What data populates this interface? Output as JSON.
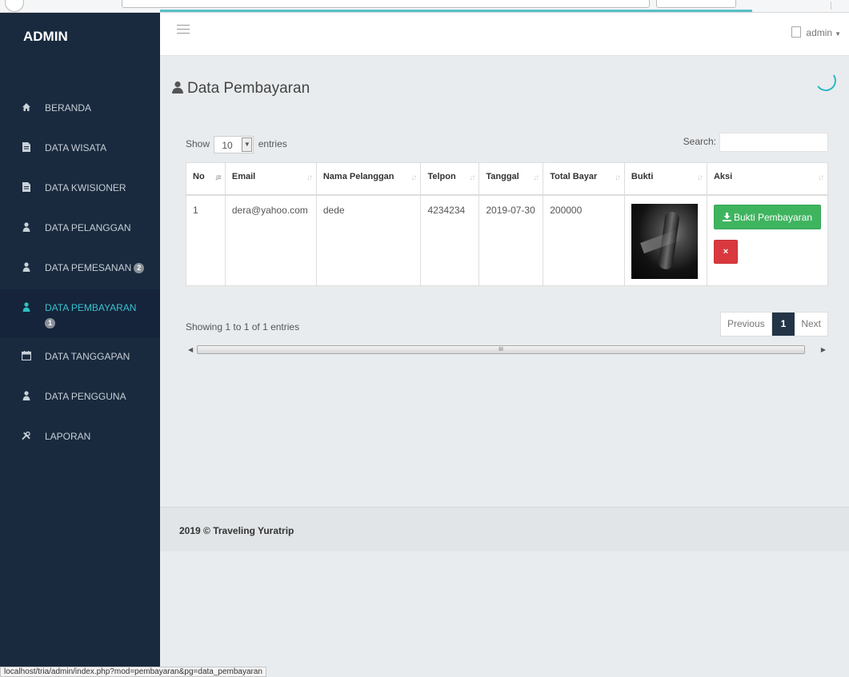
{
  "browser": {
    "status_url": "localhost/tria/admin/index.php?mod=pembayaran&pg=data_pembayaran"
  },
  "brand": "ADMIN",
  "header": {
    "user_label": "admin"
  },
  "sidebar": {
    "items": [
      {
        "label": "BERANDA",
        "icon": "home-icon"
      },
      {
        "label": "DATA WISATA",
        "icon": "file-icon"
      },
      {
        "label": "DATA KWISIONER",
        "icon": "file-icon"
      },
      {
        "label": "DATA PELANGGAN",
        "icon": "user-icon"
      },
      {
        "label": "DATA PEMESANAN",
        "icon": "user-icon",
        "badge": "2"
      },
      {
        "label": "DATA PEMBAYARAN",
        "icon": "user-icon",
        "badge": "1",
        "active": true
      },
      {
        "label": "DATA TANGGAPAN",
        "icon": "calendar-icon"
      },
      {
        "label": "DATA PENGGUNA",
        "icon": "user-icon"
      },
      {
        "label": "LAPORAN",
        "icon": "tools-icon"
      }
    ]
  },
  "page": {
    "title": "Data Pembayaran"
  },
  "table_controls": {
    "show_label": "Show",
    "entries_value": "10",
    "entries_label": "entries",
    "search_label": "Search:"
  },
  "table": {
    "columns": [
      "No",
      "Email",
      "Nama Pelanggan",
      "Telpon",
      "Tanggal",
      "Total Bayar",
      "Bukti",
      "Aksi"
    ],
    "rows": [
      {
        "no": "1",
        "email": "dera@yahoo.com",
        "nama": "dede",
        "telpon": "4234234",
        "tanggal": "2019-07-30",
        "total": "200000",
        "bukti_button": "Bukti Pembayaran",
        "delete_button": "×"
      }
    ]
  },
  "pagination": {
    "info": "Showing 1 to 1 of 1 entries",
    "previous": "Previous",
    "current": "1",
    "next": "Next"
  },
  "scrollbar_grip": "III",
  "footer": {
    "text": "2019 © Traveling Yuratrip"
  },
  "colors": {
    "sidebar_bg": "#192a3e",
    "active_text": "#3ac1d0",
    "success": "#3fb45f",
    "danger": "#d9393e",
    "pager_active": "#243447"
  }
}
